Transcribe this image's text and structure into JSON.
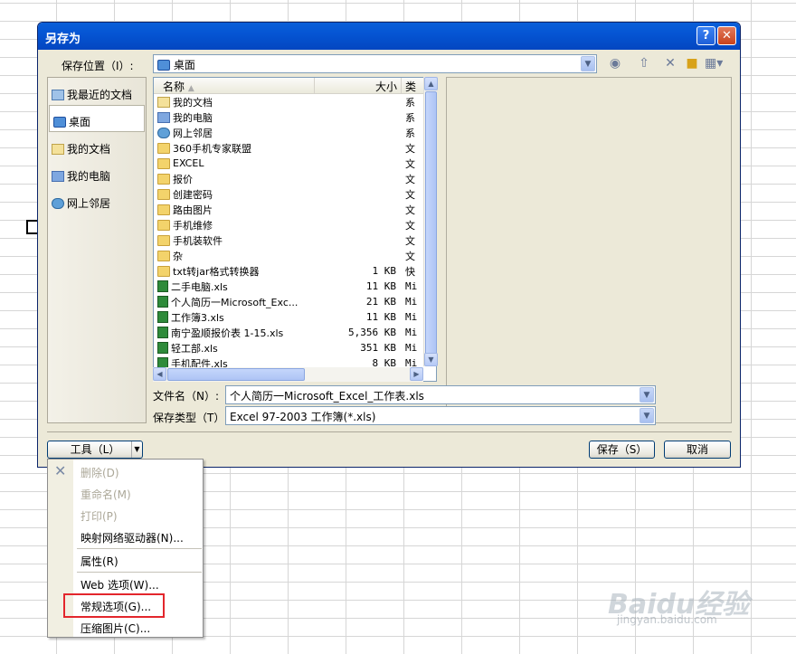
{
  "dialog": {
    "title": "另存为",
    "help_glyph": "?",
    "close_glyph": "✕",
    "save_in_label": "保存位置（I）:",
    "save_in_value": "桌面"
  },
  "places": [
    {
      "label": "我最近的文档",
      "icon": "recent"
    },
    {
      "label": "桌面",
      "icon": "desk",
      "selected": true
    },
    {
      "label": "我的文档",
      "icon": "docs"
    },
    {
      "label": "我的电脑",
      "icon": "pc"
    },
    {
      "label": "网上邻居",
      "icon": "net"
    }
  ],
  "filelist": {
    "col_name": "名称",
    "col_size": "大小",
    "col_type": "类",
    "rows": [
      {
        "name": "我的文档",
        "size": "",
        "type": "系",
        "icon": "docs"
      },
      {
        "name": "我的电脑",
        "size": "",
        "type": "系",
        "icon": "pc"
      },
      {
        "name": "网上邻居",
        "size": "",
        "type": "系",
        "icon": "net"
      },
      {
        "name": "360手机专家联盟",
        "size": "",
        "type": "文",
        "icon": "folder"
      },
      {
        "name": "EXCEL",
        "size": "",
        "type": "文",
        "icon": "folder"
      },
      {
        "name": "报价",
        "size": "",
        "type": "文",
        "icon": "folder"
      },
      {
        "name": "创建密码",
        "size": "",
        "type": "文",
        "icon": "folder"
      },
      {
        "name": "路由图片",
        "size": "",
        "type": "文",
        "icon": "folder"
      },
      {
        "name": "手机维修",
        "size": "",
        "type": "文",
        "icon": "folder"
      },
      {
        "name": "手机装软件",
        "size": "",
        "type": "文",
        "icon": "folder"
      },
      {
        "name": "杂",
        "size": "",
        "type": "文",
        "icon": "folder"
      },
      {
        "name": "txt转jar格式转换器",
        "size": "1 KB",
        "type": "快",
        "icon": "folder"
      },
      {
        "name": "二手电脑.xls",
        "size": "11 KB",
        "type": "Mi",
        "icon": "xls"
      },
      {
        "name": "个人简历一Microsoft_Exc...",
        "size": "21 KB",
        "type": "Mi",
        "icon": "xls"
      },
      {
        "name": "工作簿3.xls",
        "size": "11 KB",
        "type": "Mi",
        "icon": "xls"
      },
      {
        "name": "南宁盈顺报价表 1-15.xls",
        "size": "5,356 KB",
        "type": "Mi",
        "icon": "xls"
      },
      {
        "name": "轻工部.xls",
        "size": "351 KB",
        "type": "Mi",
        "icon": "xls"
      },
      {
        "name": "手机配件.xls",
        "size": "8 KB",
        "type": "Mi",
        "icon": "xls"
      }
    ]
  },
  "filename": {
    "label": "文件名（N）:",
    "value": "个人简历一Microsoft_Excel_工作表.xls"
  },
  "filetype": {
    "label": "保存类型（T）:",
    "value": "Excel 97-2003 工作簿(*.xls)"
  },
  "buttons": {
    "tools": "工具（L）",
    "save": "保存（S）",
    "cancel": "取消"
  },
  "tools_menu": {
    "delete": "删除(D)",
    "rename": "重命名(M)",
    "print": "打印(P)",
    "map_drive": "映射网络驱动器(N)...",
    "properties": "属性(R)",
    "web_options": "Web 选项(W)...",
    "general_options": "常规选项(G)...",
    "compress_pictures": "压缩图片(C)..."
  },
  "watermark": {
    "logo": "Baidu经验",
    "url": "jingyan.baidu.com"
  },
  "colors": {
    "titlebar": "#0555d4",
    "highlight_box": "#e3262c"
  }
}
